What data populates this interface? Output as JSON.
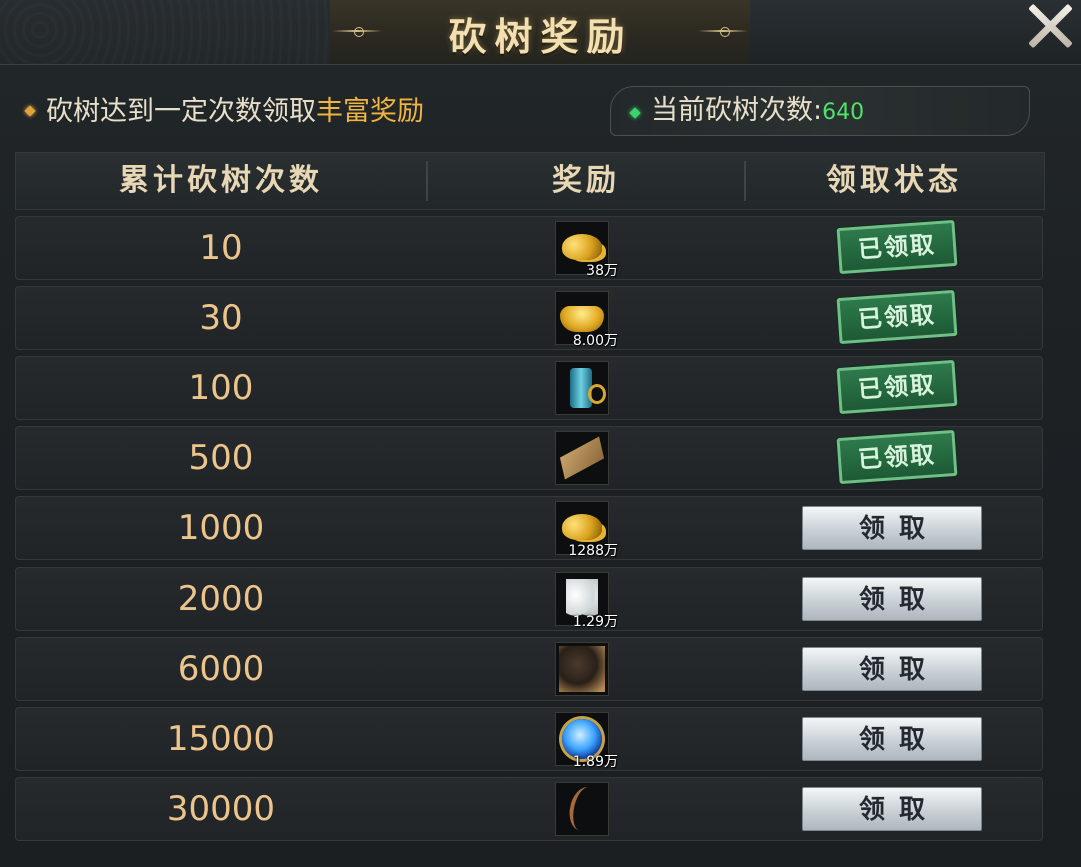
{
  "title": "砍树奖励",
  "info": {
    "prefix": "砍树达到一定次数领取",
    "highlight": "丰富奖励",
    "count_label": "当前砍树次数:",
    "count_value": "640"
  },
  "colors": {
    "accent_gold": "#f0b440",
    "count_green": "#4ee26c",
    "claimed_green": "#2e7a4b"
  },
  "table": {
    "headers": [
      "累计砍树次数",
      "奖励",
      "领取状态"
    ],
    "rows": [
      {
        "count": "10",
        "icon": "gold-coins-icon",
        "qty": "38万",
        "status": "已领取",
        "claimed": true
      },
      {
        "count": "30",
        "icon": "gold-ingot-icon",
        "qty": "8.00万",
        "status": "已领取",
        "claimed": true
      },
      {
        "count": "100",
        "icon": "scroll-icon",
        "qty": "",
        "status": "已领取",
        "claimed": true
      },
      {
        "count": "500",
        "icon": "book-icon",
        "qty": "",
        "status": "已领取",
        "claimed": true
      },
      {
        "count": "1000",
        "icon": "gold-coins-icon",
        "qty": "1288万",
        "status": "领取",
        "claimed": false
      },
      {
        "count": "2000",
        "icon": "feather-icon",
        "qty": "1.29万",
        "status": "领取",
        "claimed": false
      },
      {
        "count": "6000",
        "icon": "creature-icon",
        "qty": "",
        "status": "领取",
        "claimed": false
      },
      {
        "count": "15000",
        "icon": "blue-orb-icon",
        "qty": "1.89万",
        "status": "领取",
        "claimed": false
      },
      {
        "count": "30000",
        "icon": "vine-icon",
        "qty": "",
        "status": "领取",
        "claimed": false
      }
    ]
  }
}
